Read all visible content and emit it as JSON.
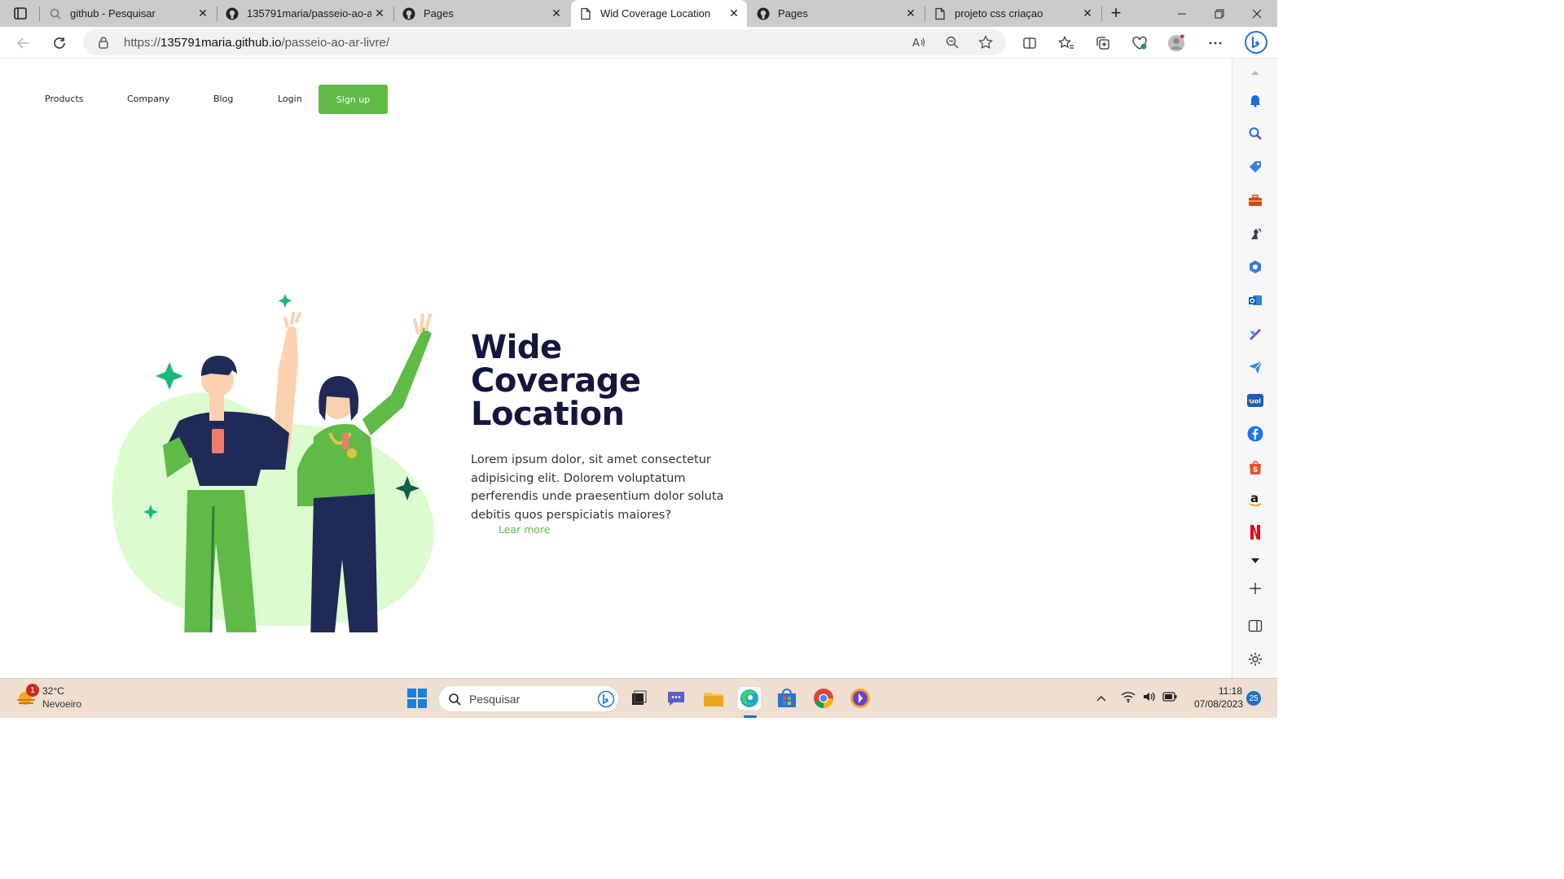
{
  "browser": {
    "tabs": [
      {
        "label": "github - Pesquisar",
        "icon": "search-icon"
      },
      {
        "label": "135791maria/passeio-ao-ar",
        "icon": "github-icon"
      },
      {
        "label": "Pages",
        "icon": "github-icon"
      },
      {
        "label": "Wid Coverage Location",
        "icon": "page-icon",
        "active": true
      },
      {
        "label": "Pages",
        "icon": "github-icon"
      },
      {
        "label": "projeto css criaçao",
        "icon": "page-icon"
      }
    ],
    "tab_close": "✕",
    "new_tab": "+",
    "url_prefix": "https://",
    "url_domain": "135791maria.github.io",
    "url_path": "/passeio-ao-ar-livre/"
  },
  "page": {
    "nav": {
      "products": "Products",
      "company": "Company",
      "blog": "Blog",
      "login": "Login",
      "signup": "Sign up"
    },
    "hero": {
      "title_line1": "Wide",
      "title_line2": "Coverage",
      "title_line3": "Location",
      "description": "Lorem ipsum dolor, sit amet consectetur adipisicing elit. Dolorem voluptatum perferendis unde praesentium dolor soluta debitis quos perspiciatis maiores?",
      "learn_more": "Lear more"
    }
  },
  "taskbar": {
    "weather_temp": "32°C",
    "weather_desc": "Nevoeiro",
    "weather_badge": "1",
    "search_placeholder": "Pesquisar",
    "time": "11:18",
    "date": "07/08/2023",
    "notification_count": "25"
  },
  "colors": {
    "accent_green": "#5fbb46",
    "title_navy": "#14163e",
    "blob_green": "#dcfccf"
  }
}
